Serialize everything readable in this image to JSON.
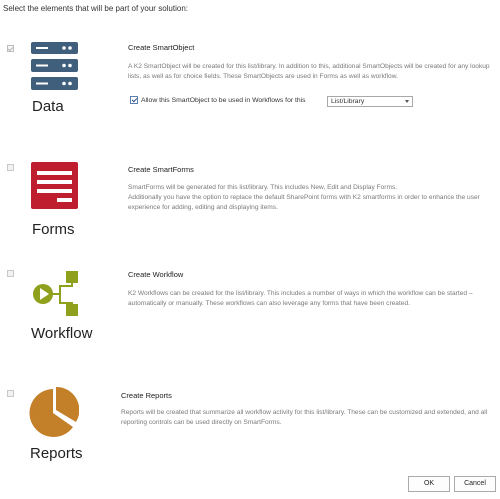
{
  "intro": "Select the elements that will be part of your solution:",
  "sections": [
    {
      "label": "Data",
      "title": "Create SmartObject",
      "checked": true,
      "description": "A K2 SmartObject will be created for this list/library. In addition to this, additional SmartObjects will be created for any lookup lists, as well as for choice fields. These SmartObjects are used in Forms as well as workflow.",
      "workflow_option": {
        "label": "Allow this SmartObject to be used in Workflows for this",
        "checked": true,
        "select_value": "List/Library"
      },
      "icon": "database-server-icon",
      "color": "#3f5f7d"
    },
    {
      "label": "Forms",
      "title": "Create SmartForms",
      "checked": false,
      "description_lines": [
        "SmartForms will be generated for this list/library. This includes New, Edit and Display Forms.",
        "Additionally you have the option to replace the default SharePoint forms with K2 smartforms in order to enhance the user experience for adding, editing and displaying items."
      ],
      "icon": "form-icon",
      "color": "#be1e2d"
    },
    {
      "label": "Workflow",
      "title": "Create Workflow",
      "checked": false,
      "description": "K2 Workflows can be created for the list/library. This includes a number of ways in which the workflow can be started – automatically or manually. These workflows can also leverage any forms that have been created.",
      "icon": "workflow-icon",
      "color": "#8fa01d"
    },
    {
      "label": "Reports",
      "title": "Create Reports",
      "checked": false,
      "description": "Reports will be created that summarize all workflow activity for this list/library. These can be customized and extended, and all reporting controls can be used directly on SmartForms.",
      "icon": "pie-chart-icon",
      "color": "#c47f29"
    }
  ],
  "buttons": {
    "ok": "OK",
    "cancel": "Cancel"
  }
}
